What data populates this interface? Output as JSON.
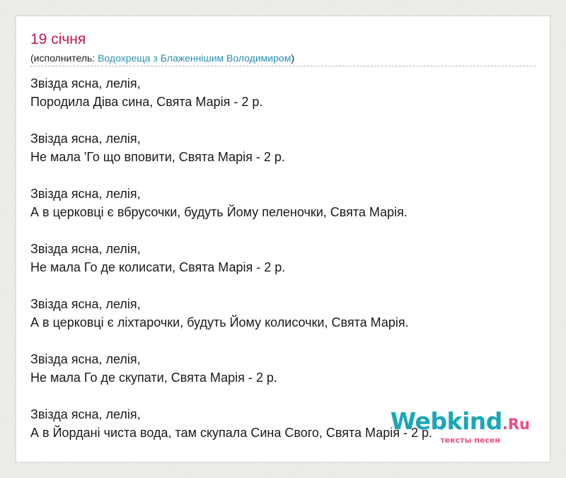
{
  "song": {
    "title": "19 січня",
    "performer_prefix": "(исполнитель: ",
    "performer_name": "Водохреща з Блаженнішим Володимиром",
    "performer_suffix": ")"
  },
  "lyrics": [
    [
      "Звізда ясна, лелія,",
      "Породила Діва сина, Свята Марія - 2 р."
    ],
    [
      "Звізда ясна, лелія,",
      "Не мала 'Го що вповити, Свята Марія - 2 р."
    ],
    [
      "Звізда ясна, лелія,",
      "А в церковці є вбрусочки, будуть Йому пеленочки, Свята Марія."
    ],
    [
      "Звізда ясна, лелія,",
      "Не мала Го де колисати, Свята Марія - 2 р."
    ],
    [
      "Звізда ясна, лелія,",
      "А в церковці є ліхтарочки, будуть Йому колисочки, Свята Марія."
    ],
    [
      "Звізда ясна, лелія,",
      "Не мала Го де скупати, Свята Марія - 2 р."
    ],
    [
      "Звізда ясна, лелія,",
      "А в Йордані чиста вода, там скупала Сина Свого, Свята Марія - 2 р."
    ]
  ],
  "watermark": {
    "name": "Webkind",
    "tld": ".Ru",
    "tagline": "тексты песен"
  },
  "colors": {
    "title": "#c2185b",
    "link": "#2a8fb5",
    "logo_main": "#1aa6b7",
    "logo_accent": "#e84d8a"
  }
}
